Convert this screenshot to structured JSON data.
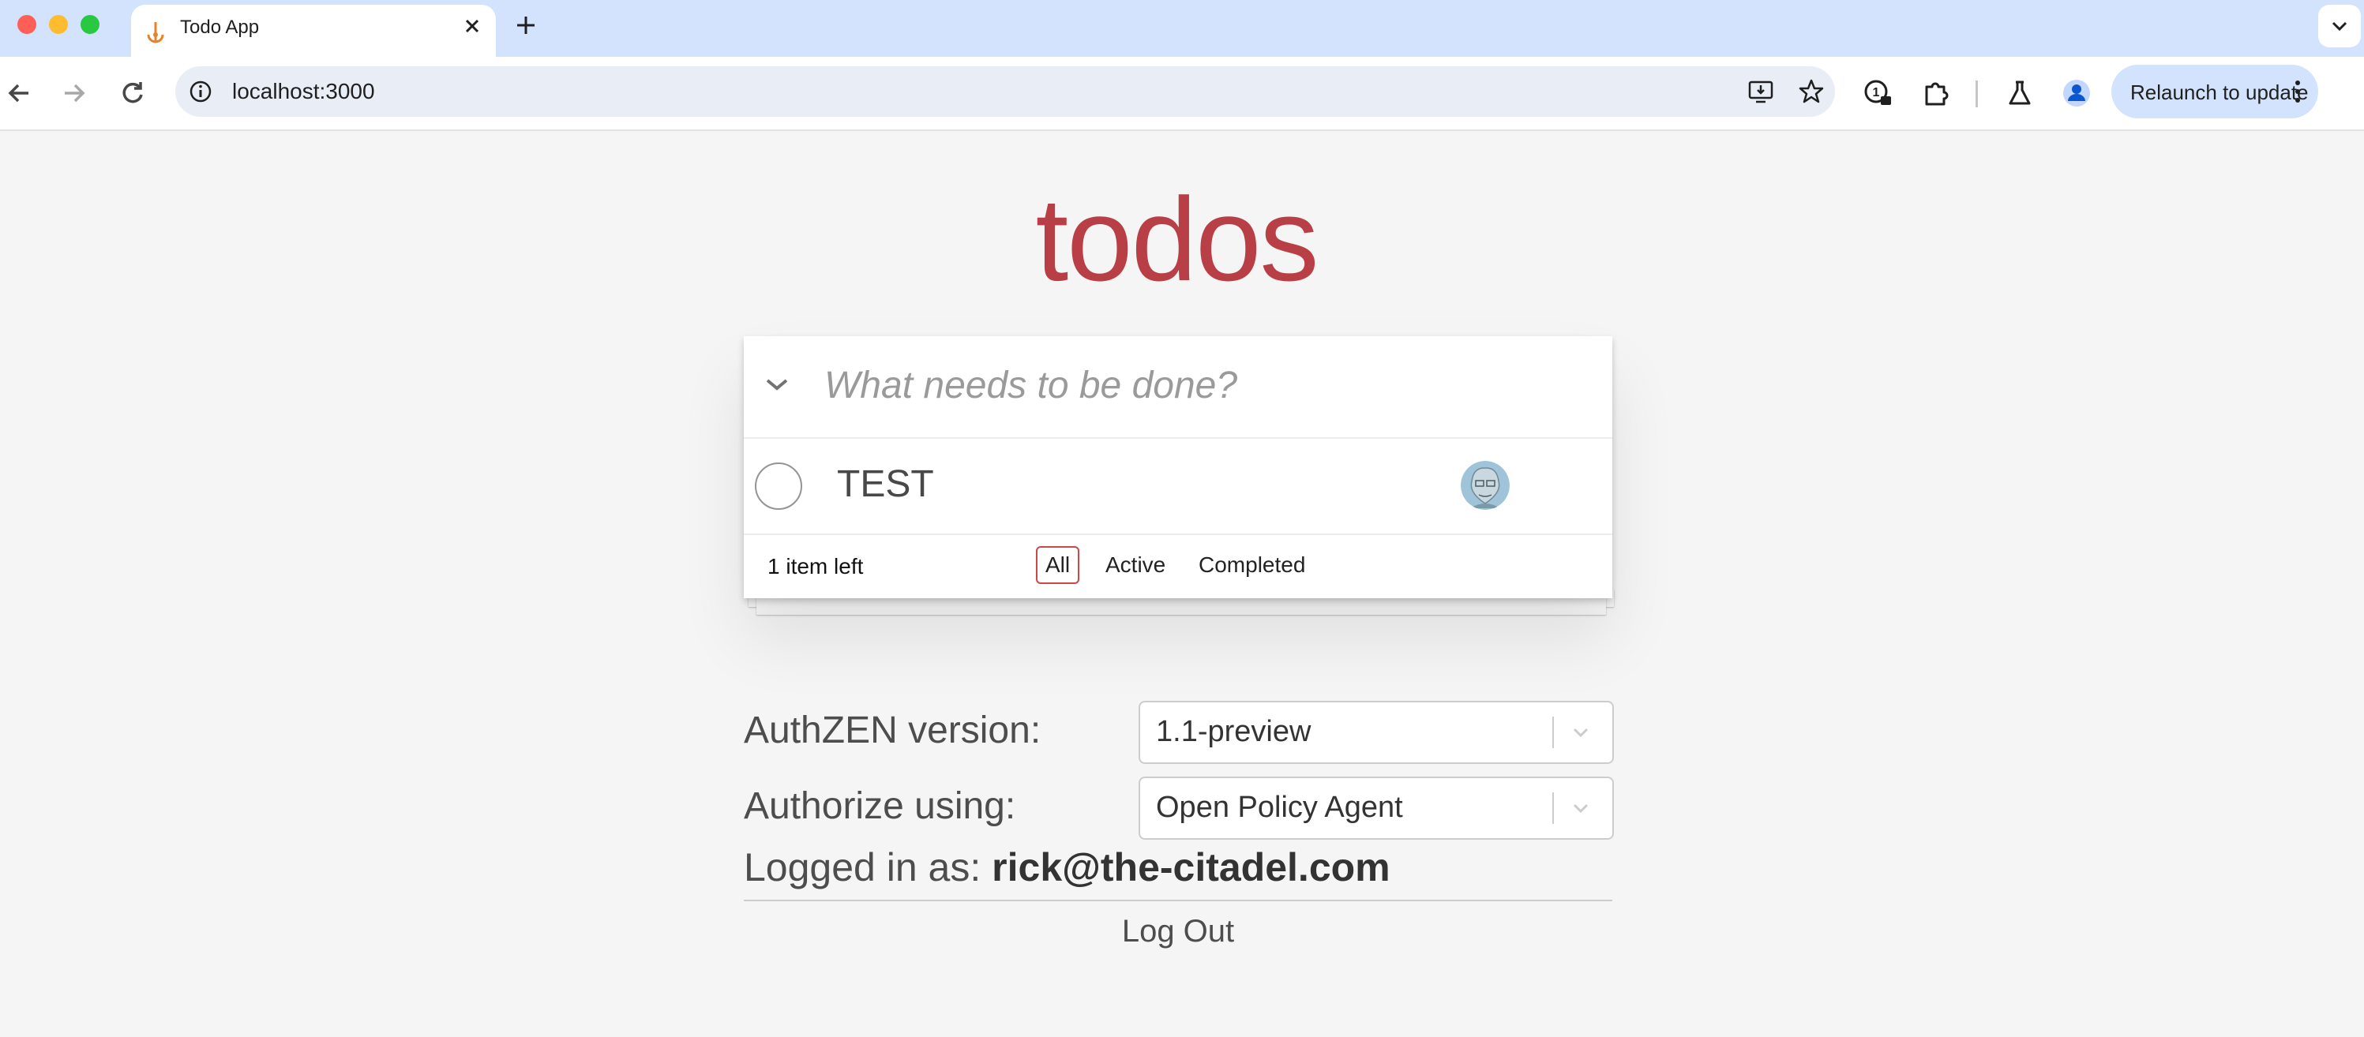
{
  "browser": {
    "tab_title": "Todo App",
    "url": "localhost:3000",
    "relaunch_label": "Relaunch to update"
  },
  "app": {
    "title": "todos",
    "new_todo_placeholder": "What needs to be done?",
    "items": [
      {
        "title": "TEST",
        "completed": false
      }
    ],
    "items_left": "1 item left",
    "filters": [
      {
        "label": "All",
        "selected": true
      },
      {
        "label": "Active",
        "selected": false
      },
      {
        "label": "Completed",
        "selected": false
      }
    ]
  },
  "settings": {
    "version_label": "AuthZEN version:",
    "version_value": "1.1-preview",
    "authorize_label": "Authorize using:",
    "authorize_value": "Open Policy Agent"
  },
  "user": {
    "logged_in_label": "Logged in as:",
    "email": "rick@the-citadel.com",
    "logout_label": "Log Out"
  },
  "colors": {
    "brand": "#b83f45",
    "selected_filter_border": "#ce4646",
    "background": "#f5f5f5",
    "tabbar": "#d3e3fd"
  }
}
